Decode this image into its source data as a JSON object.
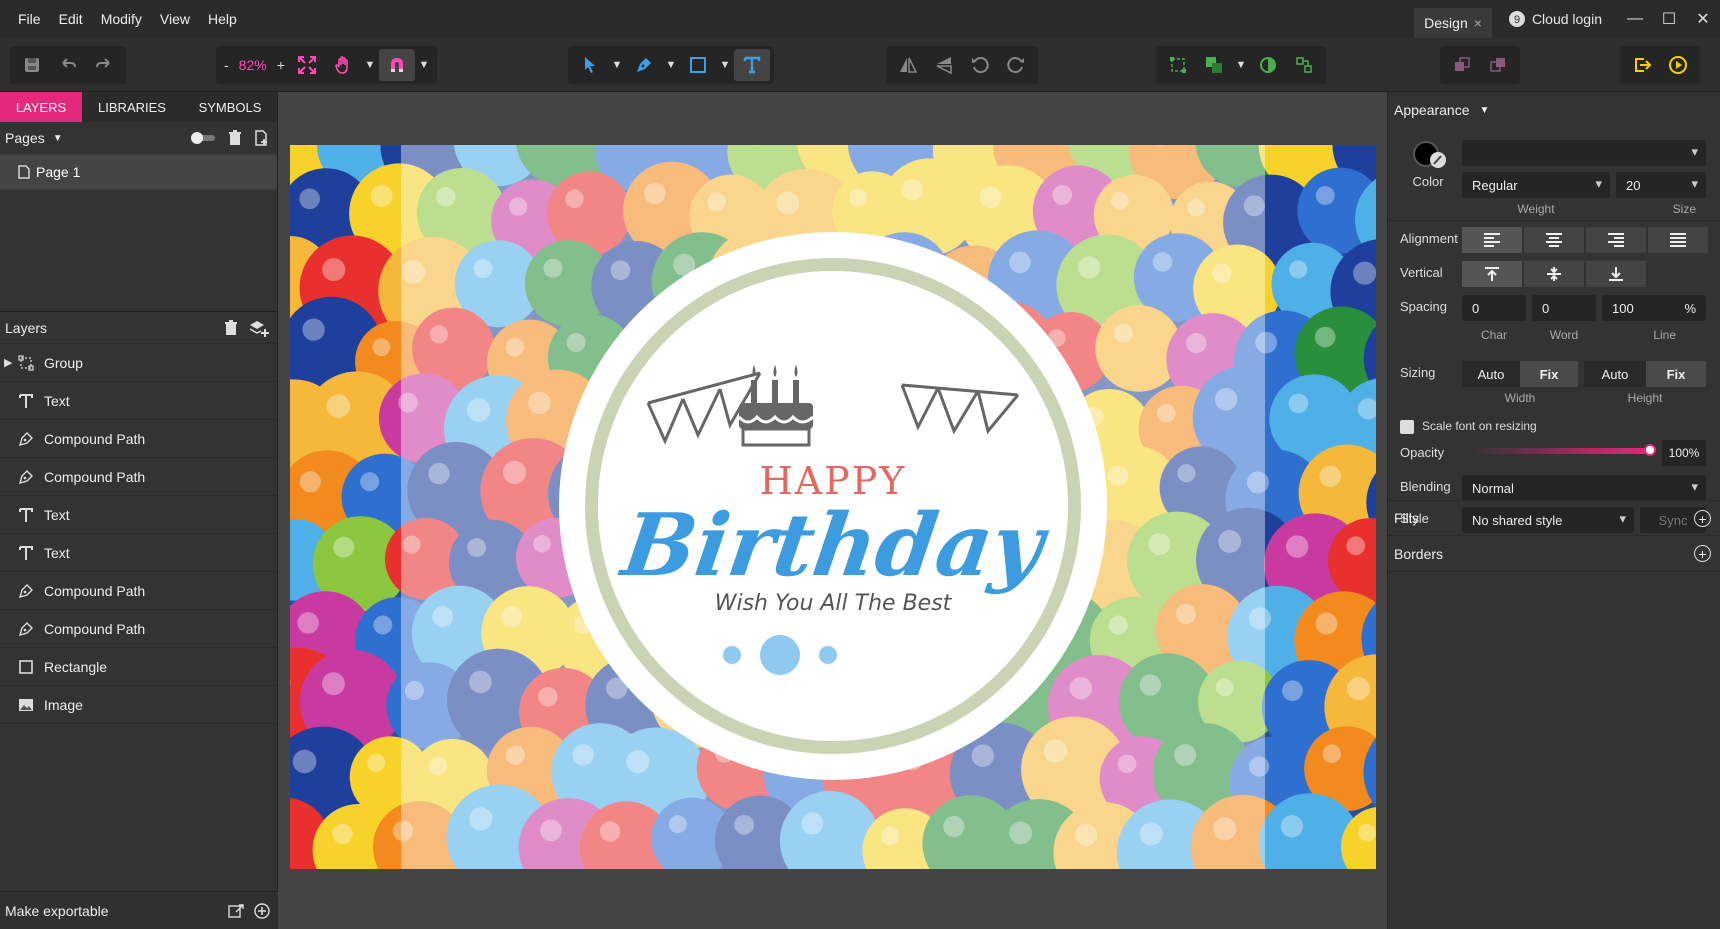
{
  "menu": [
    "File",
    "Edit",
    "Modify",
    "View",
    "Help"
  ],
  "doc_tab": {
    "label": "Design",
    "close": "×"
  },
  "cloud_login": "Cloud login",
  "window": {
    "minimize": "—",
    "maximize": "☐",
    "close": "✕"
  },
  "toolbar": {
    "zoom_minus": "-",
    "zoom_value": "82%",
    "zoom_plus": "+"
  },
  "left_tabs": [
    "LAYERS",
    "LIBRARIES",
    "SYMBOLS"
  ],
  "pages": {
    "title": "Pages",
    "items": [
      "Page 1"
    ]
  },
  "layers": {
    "title": "Layers",
    "items": [
      {
        "label": "Group",
        "icon": "group-icon"
      },
      {
        "label": "Text",
        "icon": "text-icon"
      },
      {
        "label": "Compound Path",
        "icon": "pen-icon"
      },
      {
        "label": "Compound Path",
        "icon": "pen-icon"
      },
      {
        "label": "Text",
        "icon": "text-icon"
      },
      {
        "label": "Text",
        "icon": "text-icon"
      },
      {
        "label": "Compound Path",
        "icon": "pen-icon"
      },
      {
        "label": "Compound Path",
        "icon": "pen-icon"
      },
      {
        "label": "Rectangle",
        "icon": "rectangle-icon"
      },
      {
        "label": "Image",
        "icon": "image-icon"
      }
    ]
  },
  "make_exportable": "Make exportable",
  "canvas_text": {
    "happy": "HAPPY",
    "birthday": "Birthday",
    "wish": "Wish You All The Best"
  },
  "appearance": {
    "title": "Appearance",
    "color_label": "Color",
    "font_family": "",
    "weight": "Regular",
    "weight_label": "Weight",
    "size": "20",
    "size_label": "Size",
    "alignment_label": "Alignment",
    "vertical_label": "Vertical",
    "spacing_label": "Spacing",
    "char": "0",
    "char_label": "Char",
    "word": "0",
    "word_label": "Word",
    "line": "100",
    "line_unit": "%",
    "line_label": "Line",
    "sizing_label": "Sizing",
    "width_auto": "Auto",
    "width_fix": "Fix",
    "width_label": "Width",
    "height_auto": "Auto",
    "height_fix": "Fix",
    "height_label": "Height",
    "scale_font": "Scale font on resizing",
    "opacity_label": "Opacity",
    "opacity_value": "100%",
    "opacity": 1.0,
    "blending_label": "Blending",
    "blending": "Normal",
    "style_label": "Style",
    "style": "No shared style",
    "sync": "Sync"
  },
  "fills": "Fills",
  "borders": "Borders",
  "colors": {
    "accent": "#e6287c",
    "birthday_blue": "#3d9be0",
    "happy_red": "#e3685f"
  }
}
